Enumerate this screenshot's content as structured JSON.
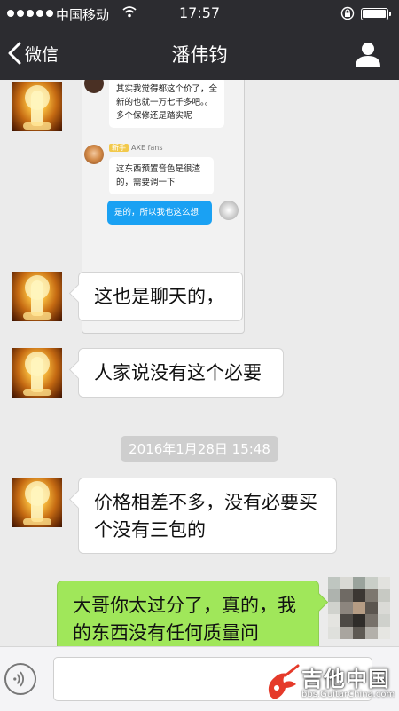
{
  "status_bar": {
    "carrier": "中国移动",
    "time": "17:57"
  },
  "nav": {
    "back_label": "微信",
    "title": "潘伟钧"
  },
  "screenshot_image": {
    "message1": "其实我觉得都这个价了，全新的也就一万七千多吧。。多个保修还是踏实呢",
    "tag_level": "新手",
    "tag_name": "AXE fans",
    "message2": "这东西预置音色是很渣的，需要调一下",
    "reply": "是的，所以我也这么想"
  },
  "messages": [
    {
      "side": "left",
      "text": "这也是聊天的，"
    },
    {
      "side": "left",
      "text": "人家说没有这个必要"
    },
    {
      "side": "left",
      "text": "价格相差不多，没有必要买个没有三包的"
    },
    {
      "side": "right",
      "text": "大哥你太过分了，真的，我的东西没有任何质量问"
    }
  ],
  "timestamp": "2016年1月28日 15:48",
  "watermark": {
    "title": "吉他中国",
    "url": "bbs.GuitarChina.com"
  },
  "colors": {
    "header_bg": "#2c2c30",
    "chat_bg": "#ebebeb",
    "self_bubble": "#a0e75a",
    "mini_blue": "#1aa1f3"
  },
  "icons": [
    "wifi-icon",
    "lock-icon",
    "battery-icon",
    "back-icon",
    "profile-icon",
    "voice-icon",
    "guitar-logo-icon"
  ]
}
